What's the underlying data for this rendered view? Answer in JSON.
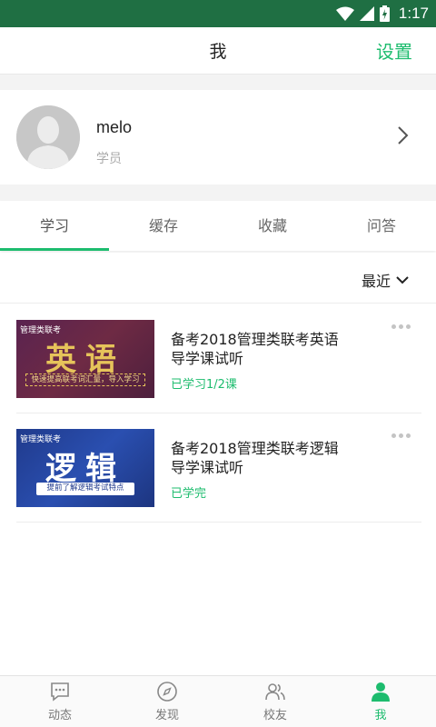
{
  "status_bar": {
    "time": "1:17"
  },
  "nav": {
    "title": "我",
    "action": "设置"
  },
  "profile": {
    "name": "melo",
    "role": "学员"
  },
  "tabs": [
    {
      "label": "学习",
      "active": true
    },
    {
      "label": "缓存",
      "active": false
    },
    {
      "label": "收藏",
      "active": false
    },
    {
      "label": "问答",
      "active": false
    }
  ],
  "sort": {
    "label": "最近"
  },
  "courses": [
    {
      "thumb_tag": "管理类联考",
      "thumb_title": "英语",
      "thumb_sub": "快速提高联考词汇量，导入学习",
      "title": "备考2018管理类联考英语导学课试听",
      "progress": "已学习1/2课"
    },
    {
      "thumb_tag": "管理类联考",
      "thumb_title": "逻辑",
      "thumb_sub": "提前了解逻辑考试特点",
      "title": "备考2018管理类联考逻辑导学课试听",
      "progress": "已学完"
    }
  ],
  "bottom_nav": [
    {
      "label": "动态",
      "icon": "chat-icon",
      "active": false
    },
    {
      "label": "发现",
      "icon": "compass-icon",
      "active": false
    },
    {
      "label": "校友",
      "icon": "friends-icon",
      "active": false
    },
    {
      "label": "我",
      "icon": "person-icon",
      "active": true
    }
  ],
  "colors": {
    "accent": "#1dbc6e",
    "status_bar": "#1f6f43"
  }
}
